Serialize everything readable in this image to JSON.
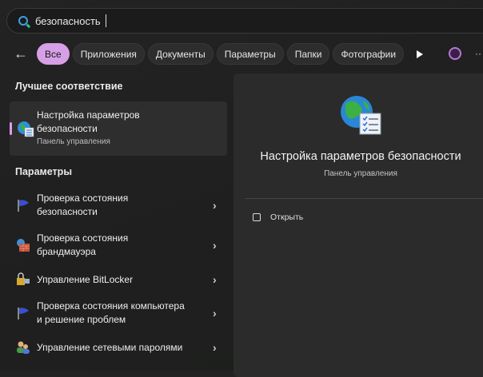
{
  "search": {
    "value": "безопасность"
  },
  "filters": {
    "back": "←",
    "chips": [
      "Все",
      "Приложения",
      "Документы",
      "Параметры",
      "Папки",
      "Фотографии"
    ]
  },
  "best_match": {
    "heading": "Лучшее соответствие",
    "title_line1": "Настройка параметров",
    "title_line2": "безопасности",
    "subtitle": "Панель управления"
  },
  "settings": {
    "heading": "Параметры",
    "items": [
      {
        "line1": "Проверка состояния",
        "line2": "безопасности"
      },
      {
        "line1": "Проверка состояния",
        "line2": "брандмауэра"
      },
      {
        "line1": "Управление BitLocker"
      },
      {
        "line1": "Проверка состояния компьютера",
        "line2": "и решение проблем"
      },
      {
        "line1": "Управление сетевыми паролями"
      }
    ]
  },
  "preview": {
    "title": "Настройка параметров безопасности",
    "subtitle": "Панель управления",
    "open_label": "Открыть"
  },
  "colors": {
    "accent": "#d69fe6",
    "panel": "#2b2b2b"
  }
}
